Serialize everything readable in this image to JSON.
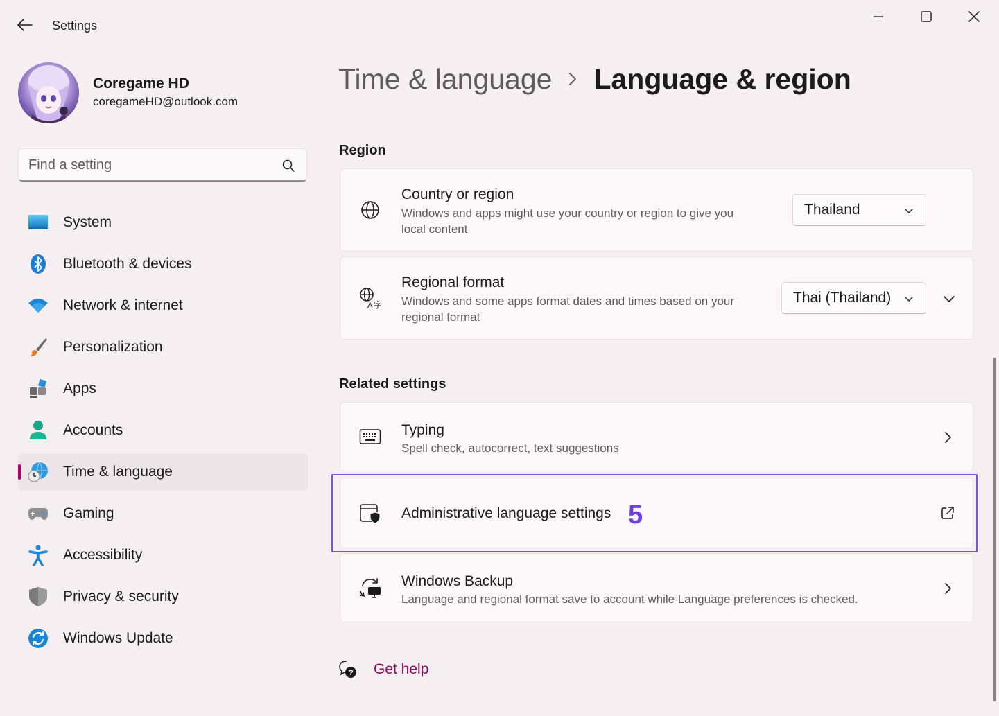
{
  "window": {
    "title": "Settings",
    "controls": [
      "minimize",
      "maximize",
      "close"
    ]
  },
  "profile": {
    "name": "Coregame HD",
    "email": "coregameHD@outlook.com"
  },
  "search": {
    "placeholder": "Find a setting"
  },
  "nav": {
    "items": [
      {
        "label": "System",
        "icon": "system-icon"
      },
      {
        "label": "Bluetooth & devices",
        "icon": "bluetooth-icon"
      },
      {
        "label": "Network & internet",
        "icon": "wifi-icon"
      },
      {
        "label": "Personalization",
        "icon": "brush-icon"
      },
      {
        "label": "Apps",
        "icon": "apps-icon"
      },
      {
        "label": "Accounts",
        "icon": "accounts-icon"
      },
      {
        "label": "Time & language",
        "icon": "time-language-icon",
        "active": true
      },
      {
        "label": "Gaming",
        "icon": "gamepad-icon"
      },
      {
        "label": "Accessibility",
        "icon": "accessibility-icon"
      },
      {
        "label": "Privacy & security",
        "icon": "shield-icon"
      },
      {
        "label": "Windows Update",
        "icon": "update-icon"
      }
    ]
  },
  "breadcrumb": {
    "parent": "Time & language",
    "current": "Language & region"
  },
  "region": {
    "label": "Region",
    "country": {
      "title": "Country or region",
      "desc_line1": "Windows and apps might use your country or region to give you",
      "desc_line2": "local content",
      "value": "Thailand"
    },
    "format": {
      "title": "Regional format",
      "desc_line1": "Windows and some apps format dates and times based on your",
      "desc_line2": "regional format",
      "value": "Thai (Thailand)"
    }
  },
  "related": {
    "label": "Related settings",
    "typing": {
      "title": "Typing",
      "desc": "Spell check, autocorrect, text suggestions"
    },
    "admin": {
      "title": "Administrative language settings"
    },
    "backup": {
      "title": "Windows Backup",
      "desc": "Language and regional format save to account while Language preferences is checked."
    }
  },
  "annotation": {
    "step": "5",
    "color": "#7b4fe0"
  },
  "help": {
    "label": "Get help"
  },
  "colors": {
    "accent": "#b0006f",
    "link": "#8b0a5b",
    "background": "#f6eff1",
    "card": "#fcf8fa"
  }
}
